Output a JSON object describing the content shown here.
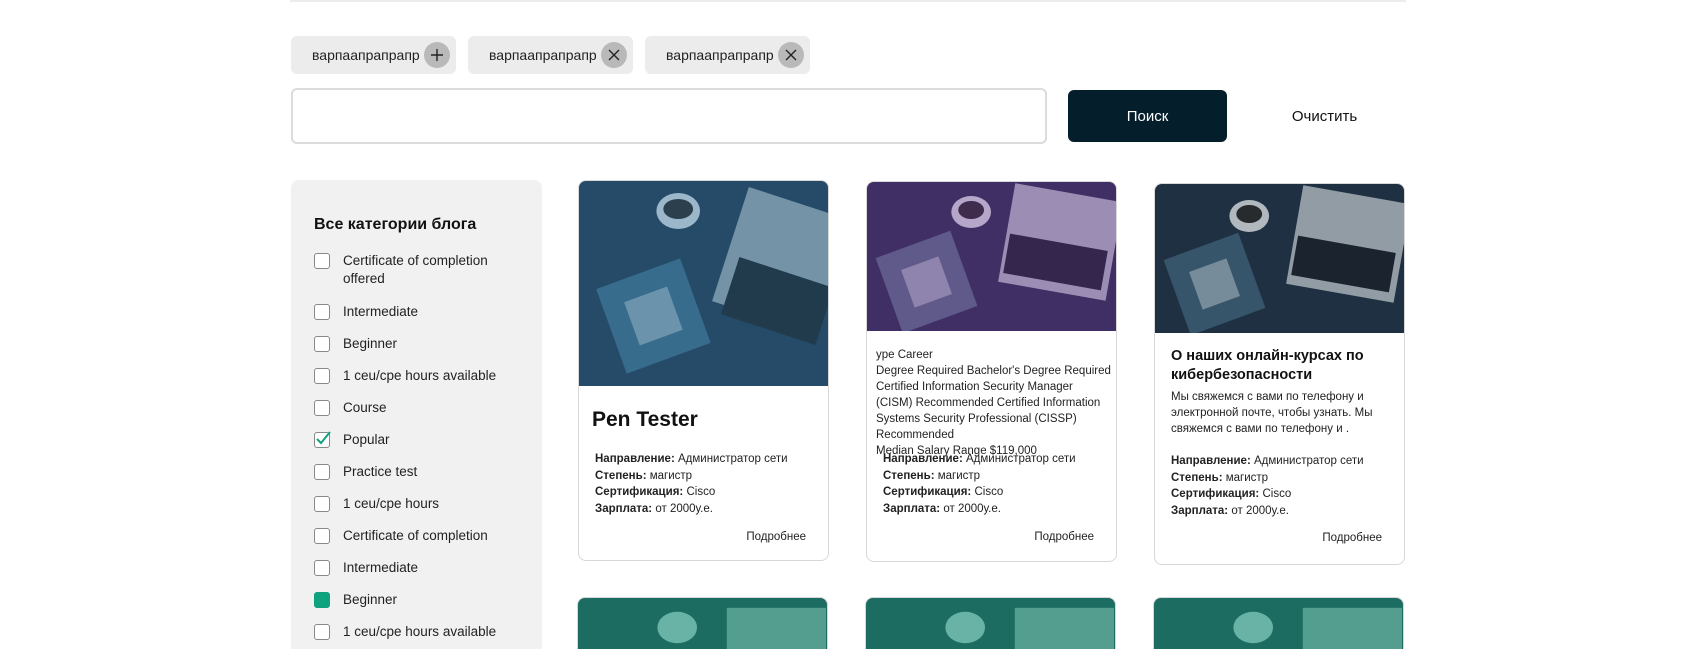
{
  "chips": [
    {
      "label": "варпаапрапрапр",
      "action": "add",
      "icon": "plus-icon"
    },
    {
      "label": "варпаапрапрапр",
      "action": "remove",
      "icon": "close-icon"
    },
    {
      "label": "варпаапрапрапр",
      "action": "remove",
      "icon": "close-icon"
    }
  ],
  "search": {
    "value": "",
    "placeholder": "",
    "button_label": "Поиск",
    "clear_label": "Очистить"
  },
  "sidebar": {
    "title": "Все категории блога",
    "categories": [
      {
        "label": "Certificate of completion offered",
        "state": "unchecked"
      },
      {
        "label": "Intermediate",
        "state": "unchecked"
      },
      {
        "label": "Beginner",
        "state": "unchecked"
      },
      {
        "label": "1 ceu/cpe hours available",
        "state": "unchecked"
      },
      {
        "label": "Course",
        "state": "unchecked"
      },
      {
        "label": "Popular",
        "state": "checked"
      },
      {
        "label": "Practice test",
        "state": "unchecked"
      },
      {
        "label": "1 ceu/cpe hours",
        "state": "unchecked"
      },
      {
        "label": "Certificate of completion",
        "state": "unchecked"
      },
      {
        "label": "Intermediate",
        "state": "unchecked"
      },
      {
        "label": "Beginner",
        "state": "filled"
      },
      {
        "label": "1 ceu/cpe hours available",
        "state": "unchecked"
      }
    ]
  },
  "cards": [
    {
      "title": "Pen Tester",
      "meta": [
        {
          "key": "Направление:",
          "value": "Администратор сети"
        },
        {
          "key": "Степень:",
          "value": "магистр"
        },
        {
          "key": "Сертификация:",
          "value": "Cisco"
        },
        {
          "key": "Зарплата:",
          "value": "от 2000у.е."
        }
      ],
      "more": "Подробнее",
      "tint": "#2f6f9a"
    },
    {
      "pre_lines": [
        "ype Career",
        "Degree Required Bachelor's Degree Required",
        "Certified Information Security Manager",
        "(CISM) Recommended Certified Information",
        "Systems Security Professional (CISSP)",
        "Recommended",
        "Median Salary Range $119,000"
      ],
      "meta": [
        {
          "key": "Направление:",
          "value": "Администратор сети"
        },
        {
          "key": "Степень:",
          "value": "магистр"
        },
        {
          "key": "Сертификация:",
          "value": "Cisco"
        },
        {
          "key": "Зарплата:",
          "value": "от 2000у.е."
        }
      ],
      "more": "Подробнее",
      "tint": "#6b3aa8"
    },
    {
      "title_lines": [
        "О наших онлайн-курсах по",
        "кибербезопасности"
      ],
      "desc_lines": [
        "Мы свяжемся с вами по телефону и",
        "электронной почте, чтобы узнать. Мы",
        "свяжемся с вами по телефону и ."
      ],
      "meta": [
        {
          "key": "Направление:",
          "value": "Администратор сети"
        },
        {
          "key": "Степень:",
          "value": "магистр"
        },
        {
          "key": "Сертификация:",
          "value": "Cisco"
        },
        {
          "key": "Зарплата:",
          "value": "от 2000у.е."
        }
      ],
      "more": "Подробнее",
      "tint": "#1e3a55"
    }
  ],
  "bottom_row_tint": "#1f8a78"
}
